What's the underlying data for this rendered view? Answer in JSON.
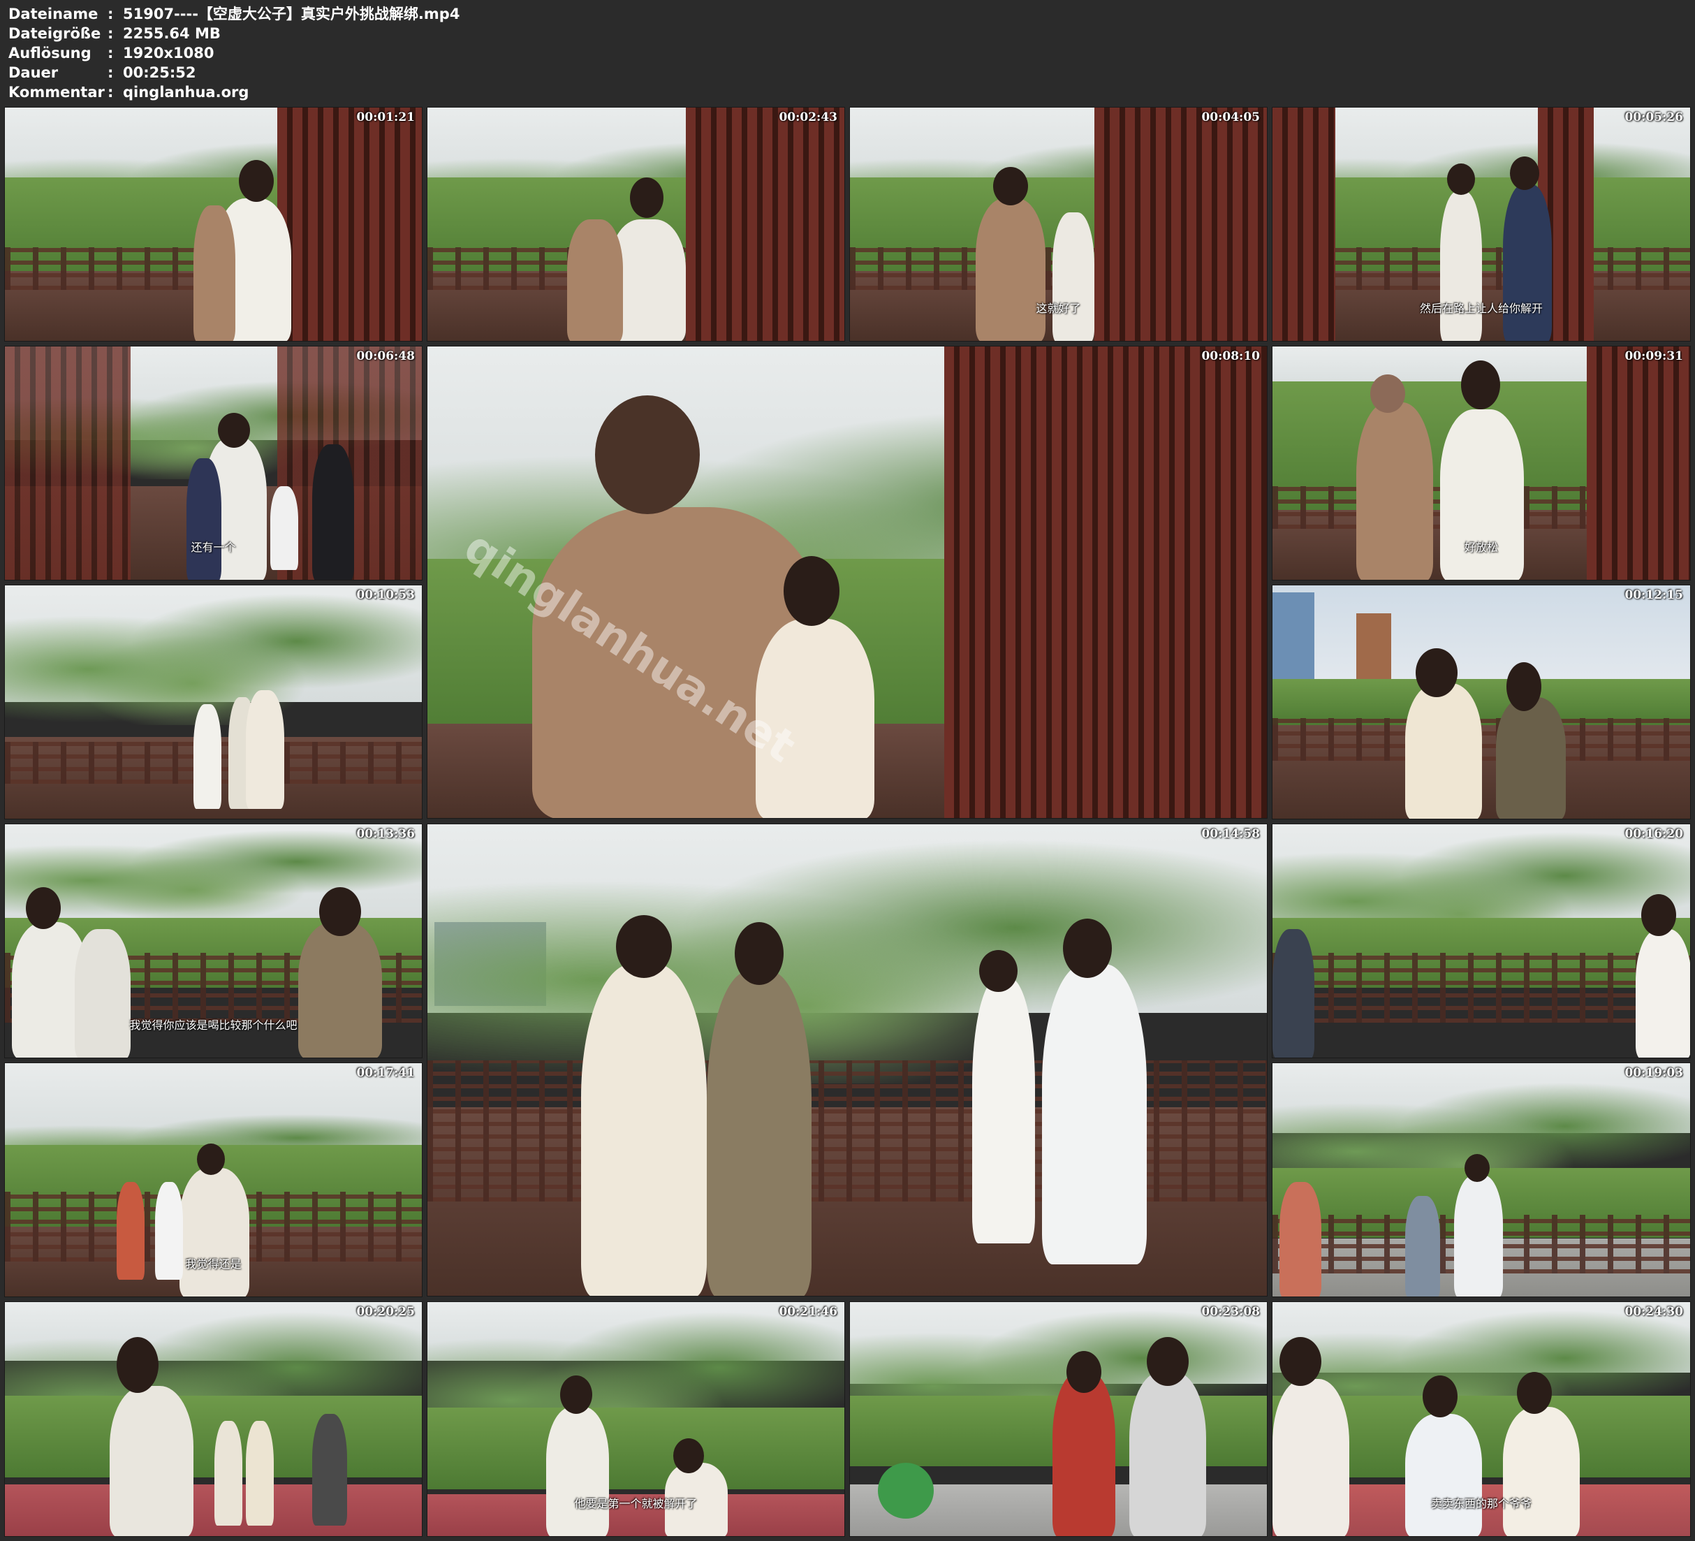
{
  "file_info": {
    "rows": [
      {
        "key": "Dateiname",
        "value": "51907----【空虚大公子】真实户外挑战解绑.mp4"
      },
      {
        "key": "Dateigröße",
        "value": "2255.64 MB"
      },
      {
        "key": "Auflösung",
        "value": "1920x1080"
      },
      {
        "key": "Dauer",
        "value": "00:25:52"
      },
      {
        "key": "Kommentar",
        "value": "qinglanhua.org"
      }
    ],
    "separator": ":"
  },
  "thumbnails": [
    {
      "timestamp": "00:01:21",
      "subtitle": ""
    },
    {
      "timestamp": "00:02:43",
      "subtitle": ""
    },
    {
      "timestamp": "00:04:05",
      "subtitle": "这就好了"
    },
    {
      "timestamp": "00:05:26",
      "subtitle": "然后在路上让人给你解开"
    },
    {
      "timestamp": "00:06:48",
      "subtitle": "还有一个"
    },
    {
      "timestamp": "00:08:10",
      "subtitle": "",
      "watermark": "qinglanhua.net"
    },
    {
      "timestamp": "00:09:31",
      "subtitle": "好放松"
    },
    {
      "timestamp": "00:10:53",
      "subtitle": ""
    },
    {
      "timestamp": "00:12:15",
      "subtitle": ""
    },
    {
      "timestamp": "00:13:36",
      "subtitle": "我觉得你应该是喝比较那个什么吧"
    },
    {
      "timestamp": "00:14:58",
      "subtitle": ""
    },
    {
      "timestamp": "00:16:20",
      "subtitle": ""
    },
    {
      "timestamp": "00:17:41",
      "subtitle": "我觉得还是"
    },
    {
      "timestamp": "00:19:03",
      "subtitle": ""
    },
    {
      "timestamp": "00:20:25",
      "subtitle": ""
    },
    {
      "timestamp": "00:21:46",
      "subtitle": "他要是第一个就被解开了"
    },
    {
      "timestamp": "00:23:08",
      "subtitle": ""
    },
    {
      "timestamp": "00:24:30",
      "subtitle": "卖卖东西的那个爷爷"
    }
  ]
}
